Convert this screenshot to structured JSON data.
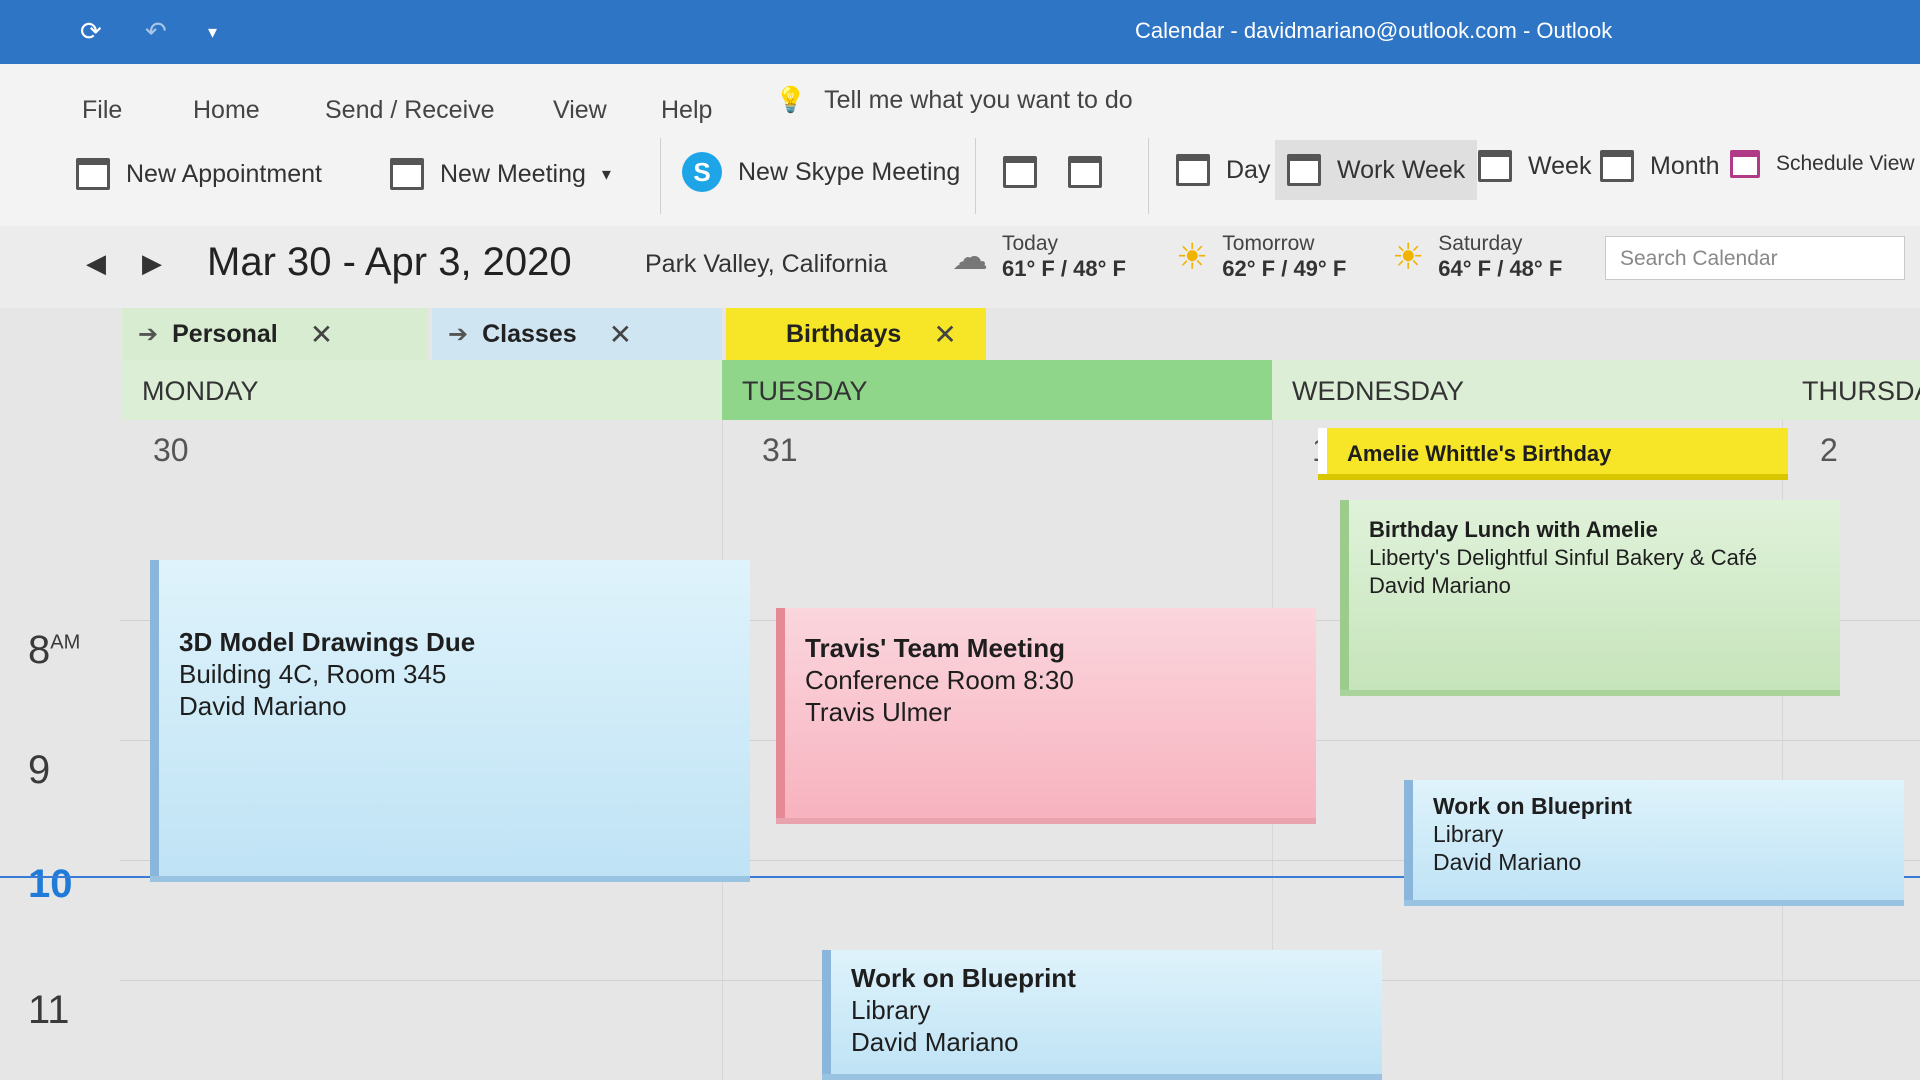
{
  "window": {
    "title": "Calendar - davidmariano@outlook.com -  Outlook"
  },
  "quick_access": {
    "sync_icon": "sync-icon",
    "undo_icon": "undo-icon",
    "customize_icon": "chevron-down-icon"
  },
  "menu": {
    "items": [
      "File",
      "Home",
      "Send / Receive",
      "View",
      "Help"
    ],
    "tell_me": "Tell me what you want to do"
  },
  "ribbon": {
    "new_appointment": "New Appointment",
    "new_meeting": "New Meeting",
    "new_skype_meeting": "New Skype Meeting",
    "skype_glyph": "S",
    "views": [
      "Day",
      "Work Week",
      "Week",
      "Month",
      "Schedule View"
    ],
    "active_view": "Work Week"
  },
  "date_nav": {
    "range": "Mar 30 - Apr 3, 2020",
    "location": "Park Valley, California",
    "weather": [
      {
        "label": "Today",
        "temp": "61° F / 48° F",
        "icon": "cloud-icon"
      },
      {
        "label": "Tomorrow",
        "temp": "62° F / 49° F",
        "icon": "sun-icon"
      },
      {
        "label": "Saturday",
        "temp": "64° F / 48° F",
        "icon": "sun-icon"
      }
    ],
    "search_placeholder": "Search Calendar"
  },
  "calendar_tabs": [
    {
      "label": "Personal",
      "color": "#d7ecd0"
    },
    {
      "label": "Classes",
      "color": "#cfe5f1"
    },
    {
      "label": "Birthdays",
      "color": "#f6e627"
    }
  ],
  "days": [
    {
      "name": "MONDAY",
      "number": "30"
    },
    {
      "name": "TUESDAY",
      "number": "31"
    },
    {
      "name": "WEDNESDAY",
      "number": "1"
    },
    {
      "name": "THURSDAY",
      "number": "2"
    }
  ],
  "hours": [
    {
      "label": "8",
      "suffix": "AM"
    },
    {
      "label": "9",
      "suffix": ""
    },
    {
      "label": "10",
      "suffix": ""
    },
    {
      "label": "11",
      "suffix": ""
    }
  ],
  "events": {
    "model_drawings": {
      "title": "3D Model Drawings Due",
      "location": "Building 4C, Room 345",
      "organizer": "David Mariano"
    },
    "team_meeting": {
      "title": "Travis' Team Meeting",
      "location": "Conference Room 8:30",
      "organizer": "Travis Ulmer"
    },
    "birthday_allday": {
      "title": "Amelie Whittle's Birthday"
    },
    "birthday_lunch": {
      "title": "Birthday Lunch with Amelie",
      "location": "Liberty's Delightful Sinful Bakery & Café",
      "organizer": "David Mariano"
    },
    "blueprint_wed": {
      "title": "Work on Blueprint",
      "location": "Library",
      "organizer": "David Mariano"
    },
    "blueprint_tue": {
      "title": "Work on Blueprint",
      "location": "Library",
      "organizer": "David Mariano"
    }
  },
  "colors": {
    "accent": "#2f75c5",
    "now_line": "#3a7bd5",
    "tuesday_header": "#8fd58a"
  }
}
